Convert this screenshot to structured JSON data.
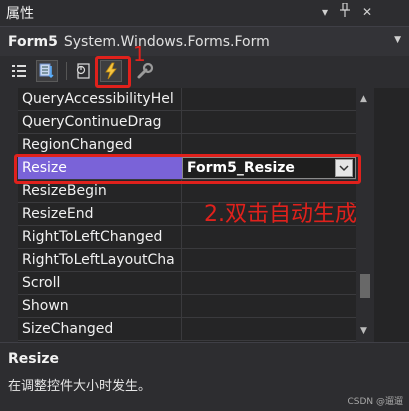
{
  "panel": {
    "title": "属性"
  },
  "object_selector": {
    "name": "Form5",
    "type": "System.Windows.Forms.Form"
  },
  "toolbar": {
    "buttons": [
      {
        "icon": "categorized-icon"
      },
      {
        "icon": "alphabetical-icon",
        "selected": true
      },
      {
        "icon": "properties-icon"
      },
      {
        "icon": "events-lightning-icon",
        "selected": true
      },
      {
        "icon": "property-pages-wrench-icon"
      }
    ]
  },
  "grid": {
    "rows": [
      {
        "name": "QueryAccessibilityHel",
        "value": ""
      },
      {
        "name": "QueryContinueDrag",
        "value": ""
      },
      {
        "name": "RegionChanged",
        "value": ""
      },
      {
        "name": "Resize",
        "value": "Form5_Resize",
        "selected": true
      },
      {
        "name": "ResizeBegin",
        "value": ""
      },
      {
        "name": "ResizeEnd",
        "value": ""
      },
      {
        "name": "RightToLeftChanged",
        "value": ""
      },
      {
        "name": "RightToLeftLayoutCha",
        "value": ""
      },
      {
        "name": "Scroll",
        "value": ""
      },
      {
        "name": "Shown",
        "value": ""
      },
      {
        "name": "SizeChanged",
        "value": ""
      }
    ]
  },
  "annotations": {
    "step1": "1",
    "step2": "2.双击自动生成"
  },
  "description": {
    "title": "Resize",
    "text": "在调整控件大小时发生。"
  },
  "watermark": "CSDN @遛遛",
  "colors": {
    "selected_row": "#7a63d8",
    "annotation_red": "#e0211c",
    "background": "#252526"
  }
}
